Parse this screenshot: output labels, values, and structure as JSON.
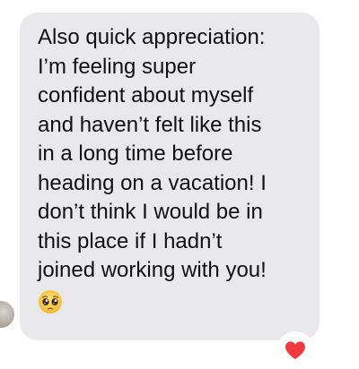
{
  "message": {
    "lines": [
      "Also quick appreciation:",
      "I’m feeling super",
      "confident about myself",
      "and haven’t felt like this",
      "in a long time before",
      "heading on a vacation! I",
      "don’t think I would be in",
      "this place if I hadn’t",
      "joined working with you!"
    ],
    "emoji": "pleading-face-emoji"
  },
  "reaction": {
    "icon": "heart-icon",
    "color": "#f23a3c"
  },
  "colors": {
    "bubble": "#e9e9eb",
    "text": "#111111",
    "background": "#ffffff"
  }
}
